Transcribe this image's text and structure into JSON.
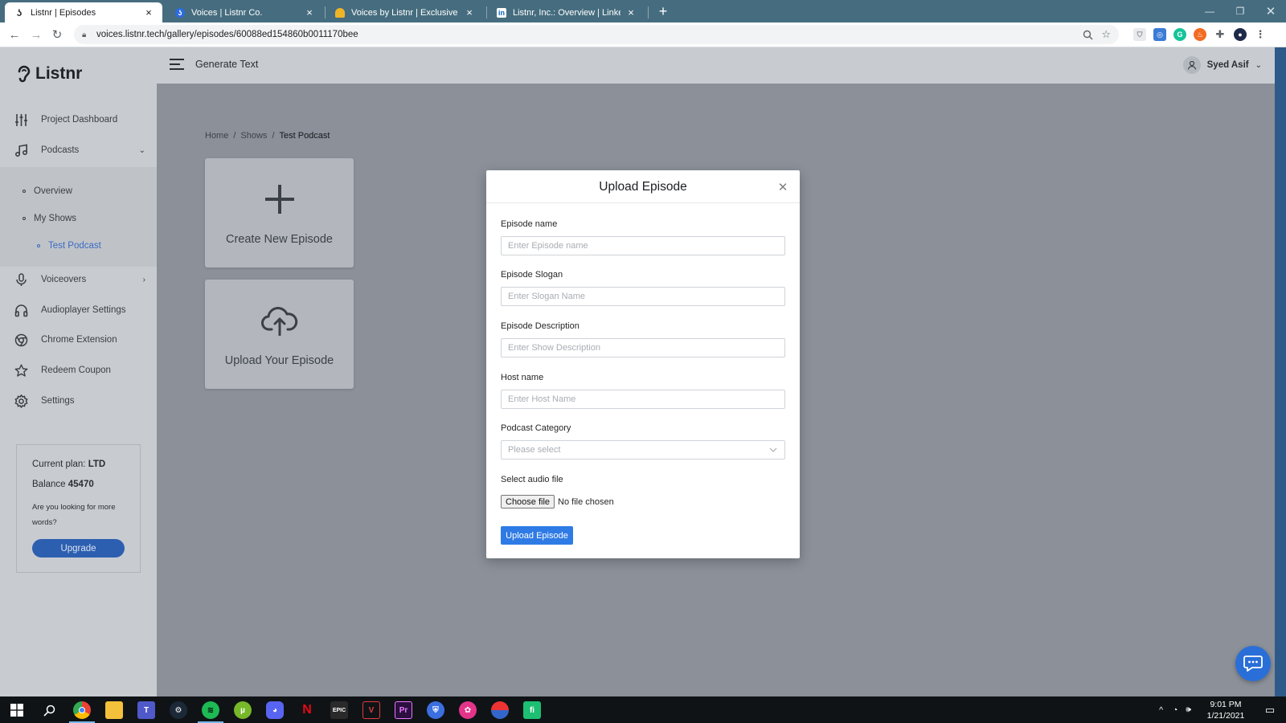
{
  "browser": {
    "tabs": [
      {
        "title": "Listnr | Episodes",
        "active": true
      },
      {
        "title": "Voices | Listnr Co.",
        "active": false
      },
      {
        "title": "Voices by Listnr | Exclusive Offer",
        "active": false
      },
      {
        "title": "Listnr, Inc.: Overview | LinkedIn",
        "active": false
      }
    ],
    "url": "voices.listnr.tech/gallery/episodes/60088ed154860b0011170bee"
  },
  "app": {
    "brand": "Listnr",
    "topbar": {
      "generate_text": "Generate Text",
      "user_name": "Syed Asif"
    },
    "sidebar": {
      "items": [
        {
          "label": "Project Dashboard",
          "icon": "sliders-icon"
        },
        {
          "label": "Podcasts",
          "icon": "music-note-icon"
        },
        {
          "label": "Voiceovers",
          "icon": "microphone-icon"
        },
        {
          "label": "Audioplayer Settings",
          "icon": "headphones-icon"
        },
        {
          "label": "Chrome Extension",
          "icon": "chrome-icon"
        },
        {
          "label": "Redeem Coupon",
          "icon": "star-icon"
        },
        {
          "label": "Settings",
          "icon": "gear-icon"
        }
      ],
      "podcasts_sub": [
        "Overview",
        "My Shows",
        "Test Podcast"
      ]
    },
    "plan": {
      "plan_label": "Current plan:",
      "plan_value": "LTD",
      "balance_label": "Balance",
      "balance_value": "45470",
      "hint": "Are you looking for more words?",
      "upgrade": "Upgrade"
    },
    "breadcrumb": [
      "Home",
      "Shows",
      "Test Podcast"
    ],
    "cards": [
      {
        "label": "Create New Episode",
        "icon": "plus-icon"
      },
      {
        "label": "Upload Your Episode",
        "icon": "cloud-upload-icon"
      }
    ]
  },
  "modal": {
    "title": "Upload Episode",
    "fields": {
      "episode_name": {
        "label": "Episode name",
        "placeholder": "Enter Episode name"
      },
      "episode_slogan": {
        "label": "Episode Slogan",
        "placeholder": "Enter Slogan Name"
      },
      "episode_description": {
        "label": "Episode Description",
        "placeholder": "Enter Show Description"
      },
      "host_name": {
        "label": "Host name",
        "placeholder": "Enter Host Name"
      },
      "podcast_category": {
        "label": "Podcast Category",
        "placeholder": "Please select"
      },
      "audio_file": {
        "label": "Select audio file",
        "button": "Choose file",
        "status": "No file chosen"
      }
    },
    "submit": "Upload Episode"
  },
  "taskbar": {
    "time": "9:01 PM",
    "date": "1/21/2021"
  }
}
